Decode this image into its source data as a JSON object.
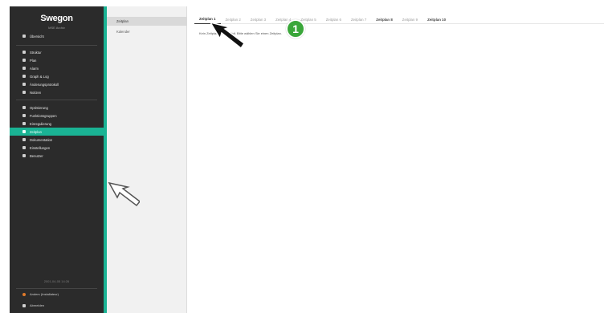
{
  "sidebar": {
    "brand": "Swegon",
    "brand_sub": "MSE Archiv",
    "items": [
      {
        "label": "Übersicht",
        "icon": "eye-icon"
      },
      {
        "label": "Struktur",
        "icon": "structure-icon"
      },
      {
        "label": "Plan",
        "icon": "location-pin-icon"
      },
      {
        "label": "Alarm",
        "icon": "bell-icon"
      },
      {
        "label": "Graph & Log",
        "icon": "graph-icon"
      },
      {
        "label": "Änderungsprotokoll",
        "icon": "list-icon"
      },
      {
        "label": "Notizen",
        "icon": "comment-icon"
      },
      {
        "label": "Optimierung",
        "icon": "optimize-icon"
      },
      {
        "label": "Funktionsgruppen",
        "icon": "group-icon"
      },
      {
        "label": "Einregulierung",
        "icon": "table-icon"
      },
      {
        "label": "Zeitplan",
        "icon": "calendar-icon"
      },
      {
        "label": "Dokumentation",
        "icon": "document-icon"
      },
      {
        "label": "Einstellungen",
        "icon": "gear-icon"
      },
      {
        "label": "Benutzer",
        "icon": "users-icon"
      }
    ],
    "footer_text": "2001-04-05 14:26",
    "footer_items": [
      {
        "label": "Anders (Installateur)",
        "icon": "user-icon"
      },
      {
        "label": "Abmelden",
        "icon": "logout-icon"
      }
    ]
  },
  "subpanel": {
    "items": [
      "Zeitplan",
      "Kalender"
    ]
  },
  "main": {
    "tabs": [
      "Zeitplan 1",
      "Zeitplan 2",
      "Zeitplan 3",
      "Zeitplan 4",
      "Zeitplan 5",
      "Zeitplan 6",
      "Zeitplan 7",
      "Zeitplan 8",
      "Zeitplan 9",
      "Zeitplan 10"
    ],
    "info_text": "Kein Zeitplan ausgewählt. Bitte wählen Sie einen Zeitplan."
  },
  "overlay": {
    "badge_number": "1"
  },
  "colors": {
    "accent": "#1ab394",
    "sidebar_bg": "#2b2b2b",
    "badge": "#3aa63a"
  }
}
